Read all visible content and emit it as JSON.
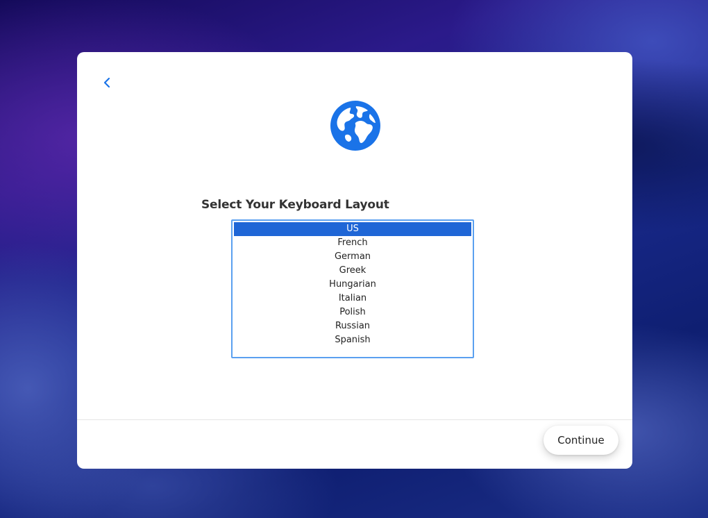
{
  "dialog": {
    "heading": "Select Your Keyboard Layout",
    "back_icon": "chevron-left-icon",
    "globe_icon": "globe-icon",
    "accent_color": "#1a73e8"
  },
  "layouts": {
    "items": [
      "US",
      "French",
      "German",
      "Greek",
      "Hungarian",
      "Italian",
      "Polish",
      "Russian",
      "Spanish"
    ],
    "selected": "US"
  },
  "footer": {
    "continue_label": "Continue"
  }
}
